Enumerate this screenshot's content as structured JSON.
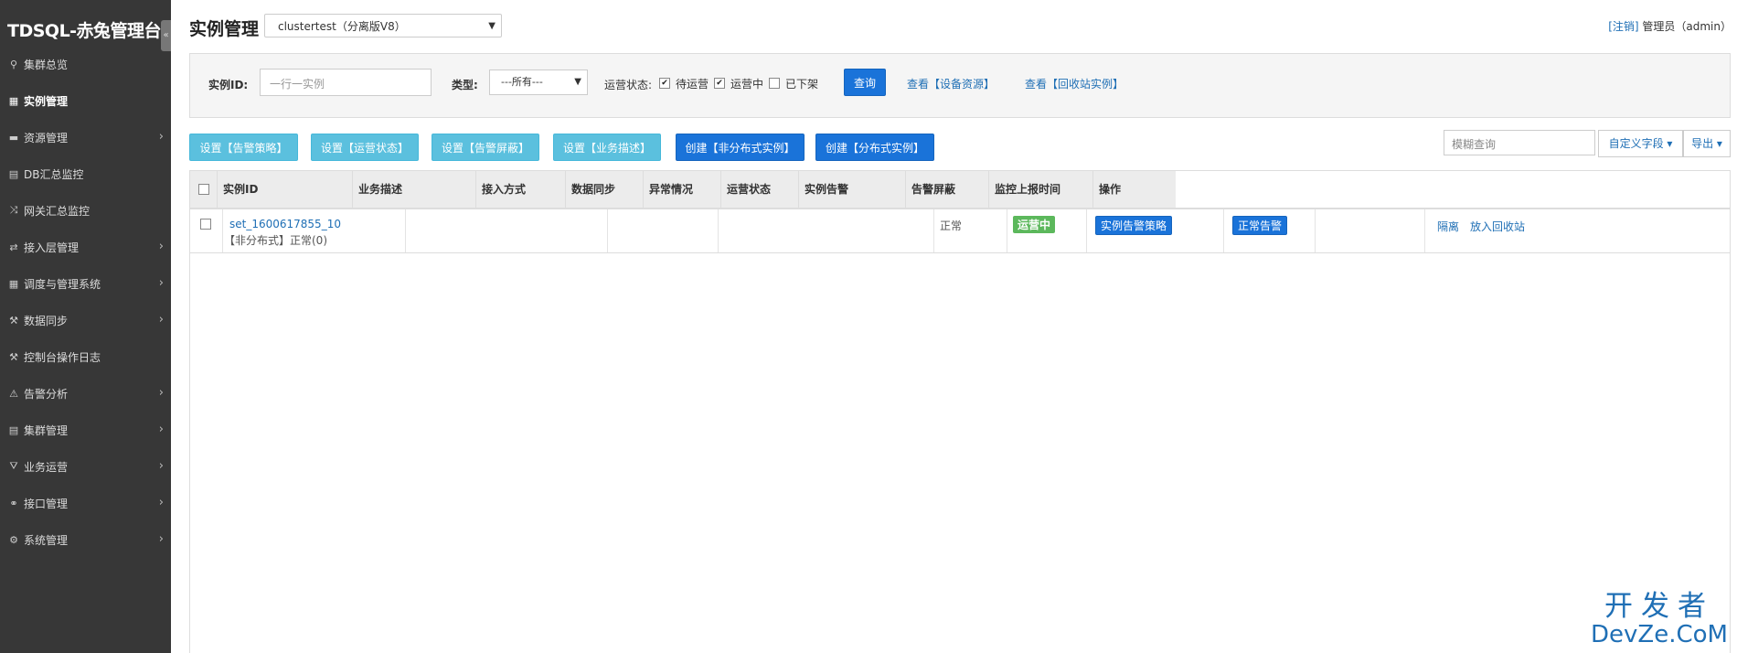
{
  "sidebar": {
    "brand": "TDSQL-赤兔管理台",
    "collapse_glyph": "«",
    "items": [
      {
        "label": "集群总览",
        "icon": "search-icon",
        "glyph": "⚲",
        "chevron": false,
        "active": false
      },
      {
        "label": "实例管理",
        "icon": "grid-icon",
        "glyph": "▦",
        "chevron": false,
        "active": true
      },
      {
        "label": "资源管理",
        "icon": "drive-icon",
        "glyph": "▬",
        "chevron": true,
        "active": false
      },
      {
        "label": "DB汇总监控",
        "icon": "list-icon",
        "glyph": "▤",
        "chevron": false,
        "active": false
      },
      {
        "label": "网关汇总监控",
        "icon": "shuffle-icon",
        "glyph": "⤨",
        "chevron": false,
        "active": false
      },
      {
        "label": "接入层管理",
        "icon": "retweet-icon",
        "glyph": "⇄",
        "chevron": true,
        "active": false
      },
      {
        "label": "调度与管理系统",
        "icon": "grid-icon",
        "glyph": "▦",
        "chevron": true,
        "active": false
      },
      {
        "label": "数据同步",
        "icon": "wrench-icon",
        "glyph": "⚒",
        "chevron": true,
        "active": false
      },
      {
        "label": "控制台操作日志",
        "icon": "wrench-icon",
        "glyph": "⚒",
        "chevron": false,
        "active": false
      },
      {
        "label": "告警分析",
        "icon": "warning-icon",
        "glyph": "⚠",
        "chevron": true,
        "active": false
      },
      {
        "label": "集群管理",
        "icon": "list-icon",
        "glyph": "▤",
        "chevron": true,
        "active": false
      },
      {
        "label": "业务运营",
        "icon": "road-icon",
        "glyph": "⛛",
        "chevron": true,
        "active": false
      },
      {
        "label": "接口管理",
        "icon": "link-icon",
        "glyph": "⚭",
        "chevron": true,
        "active": false
      },
      {
        "label": "系统管理",
        "icon": "gear-icon",
        "glyph": "⚙",
        "chevron": true,
        "active": false
      }
    ]
  },
  "header": {
    "title": "实例管理",
    "cluster_selected": "clustertest（分离版V8）",
    "logout_label": "[注销]",
    "user_label": "管理员（admin）"
  },
  "filter": {
    "instance_id_label": "实例ID:",
    "instance_id_placeholder": "一行一实例",
    "type_label": "类型:",
    "type_selected": "---所有---",
    "status_label": "运营状态:",
    "status_options": [
      {
        "label": "待运营",
        "checked": true
      },
      {
        "label": "运营中",
        "checked": true
      },
      {
        "label": "已下架",
        "checked": false
      }
    ],
    "query_label": "查询",
    "view_device_label": "查看【设备资源】",
    "view_recycle_label": "查看【回收站实例】"
  },
  "actions": {
    "set_alarm_policy": "设置【告警策略】",
    "set_run_status": "设置【运营状态】",
    "set_alarm_mask": "设置【告警屏蔽】",
    "set_business_desc": "设置【业务描述】",
    "create_nondistributed": "创建【非分布式实例】",
    "create_distributed": "创建【分布式实例】",
    "fuzzy_placeholder": "模糊查询",
    "custom_fields": "自定义字段",
    "export": "导出"
  },
  "table": {
    "columns": [
      "实例ID",
      "业务描述",
      "接入方式",
      "数据同步",
      "异常情况",
      "运营状态",
      "实例告警",
      "告警屏蔽",
      "监控上报时间",
      "操作"
    ],
    "rows": [
      {
        "instance_id": "set_1600617855_10",
        "instance_sub": "【非分布式】正常(0)",
        "business_desc": "",
        "access": "",
        "sync": "",
        "abnormal": "正常",
        "run_status": "运营中",
        "instance_alarm": "实例告警策略",
        "alarm_mask": "正常告警",
        "report_time": "",
        "op_isolate": "隔离",
        "op_recycle": "放入回收站"
      }
    ]
  },
  "watermark": {
    "line1": "开发者",
    "line2": "DevZe.CoM"
  },
  "colors": {
    "sidebar_bg": "#373737",
    "primary": "#1a73d9",
    "info": "#5bc0de",
    "success": "#5cb85c",
    "link": "#1f6fb5"
  }
}
